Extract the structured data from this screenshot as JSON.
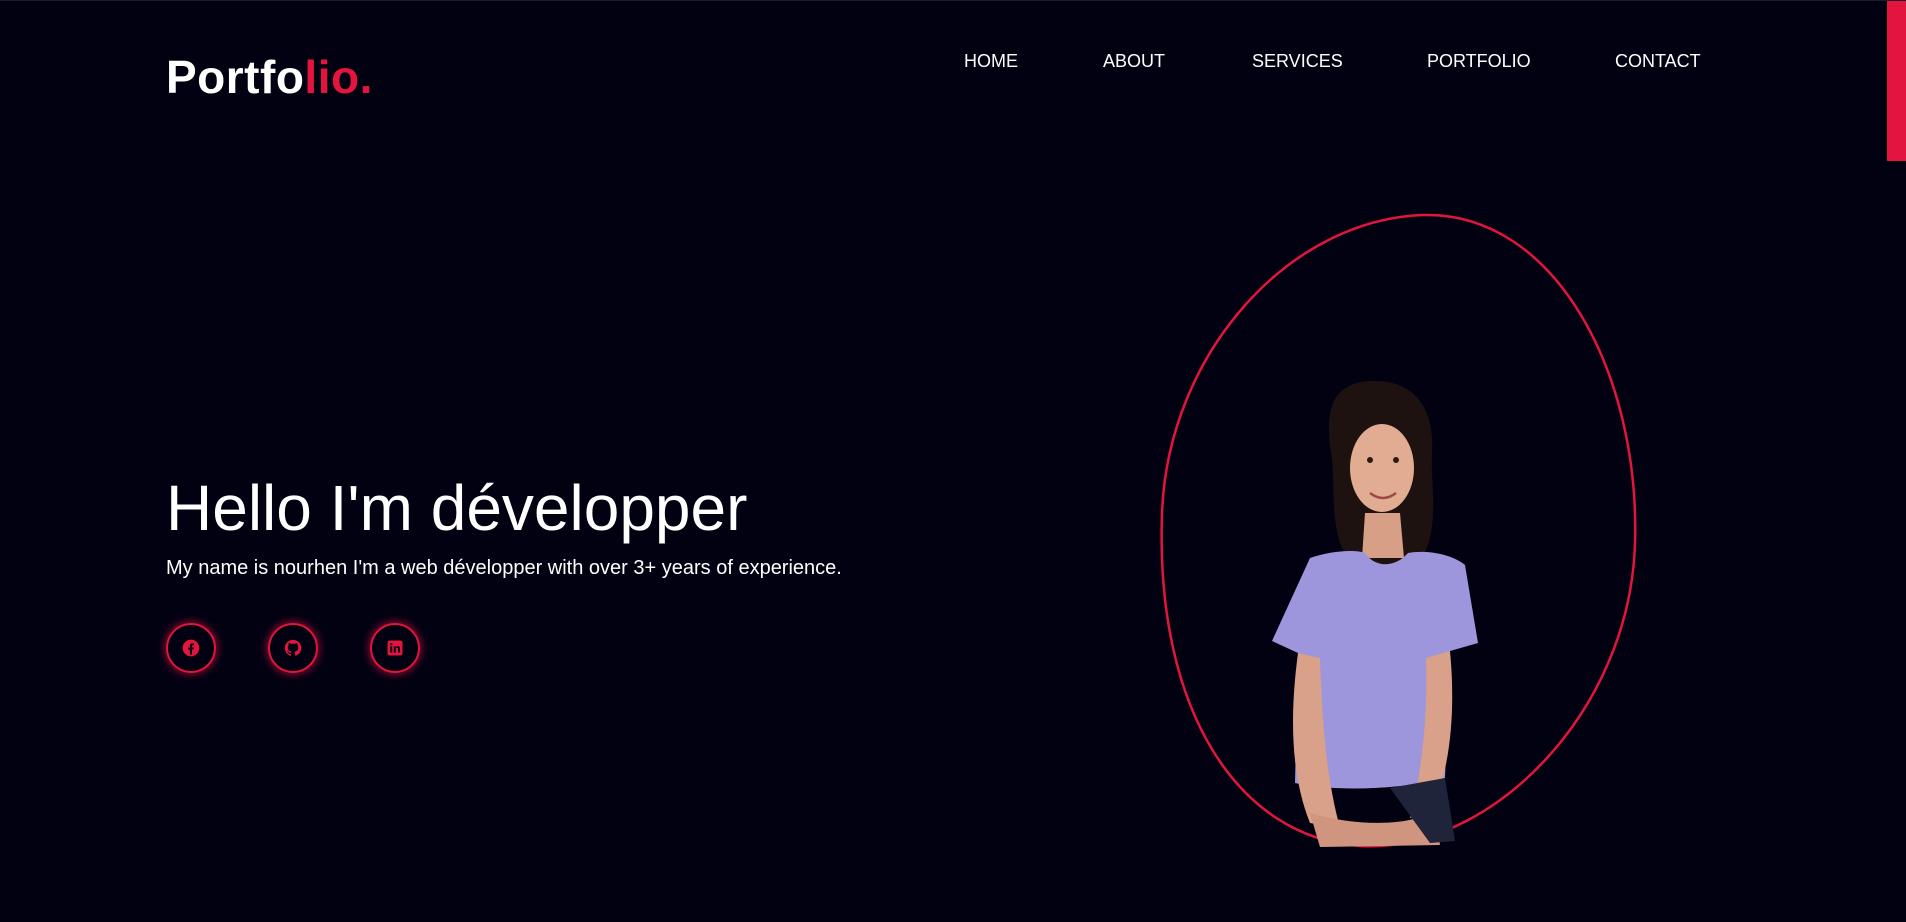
{
  "header": {
    "logo_main": "Portfo",
    "logo_accent": "lio."
  },
  "nav": {
    "items": [
      {
        "label": "HOME"
      },
      {
        "label": "ABOUT"
      },
      {
        "label": "SERVICES"
      },
      {
        "label": "PORTFOLIO"
      },
      {
        "label": "CONTACT"
      }
    ]
  },
  "hero": {
    "title": "Hello I'm développer",
    "subtitle": "My name is nourhen I'm a web développer with over 3+ years of experience."
  },
  "socials": [
    {
      "icon": "facebook-icon"
    },
    {
      "icon": "github-icon"
    },
    {
      "icon": "linkedin-icon"
    }
  ],
  "colors": {
    "background": "#010112",
    "accent": "#e3143e",
    "text": "#ffffff",
    "shirt": "#9e96dc"
  }
}
